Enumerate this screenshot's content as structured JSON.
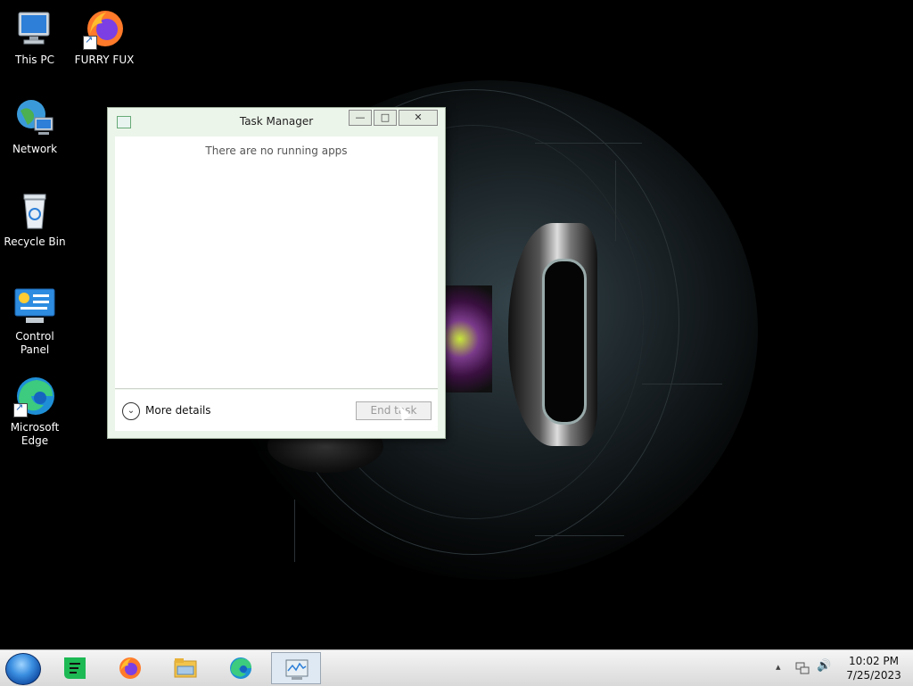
{
  "desktop": {
    "icons": [
      {
        "label": "This PC",
        "icon": "computer-icon"
      },
      {
        "label": "FURRY FUX",
        "icon": "firefox-icon"
      },
      {
        "label": "Network",
        "icon": "network-icon"
      },
      {
        "label": "Recycle Bin",
        "icon": "recycle-bin-icon"
      },
      {
        "label": "Control Panel",
        "icon": "control-panel-icon"
      },
      {
        "label": "Microsoft Edge",
        "icon": "edge-icon"
      }
    ]
  },
  "task_manager": {
    "title": "Task Manager",
    "empty_message": "There are no running apps",
    "more_details_label": "More details",
    "end_task_label": "End task",
    "minimize_glyph": "—",
    "maximize_glyph": "□",
    "close_glyph": "✕"
  },
  "taskbar": {
    "items": [
      "sheets-icon",
      "firefox-icon",
      "file-explorer-icon",
      "edge-icon",
      "task-manager-icon"
    ],
    "tray_glyphs": {
      "chevron": "▴",
      "volume": "🔊"
    },
    "time": "10:02 PM",
    "date": "7/25/2023"
  },
  "colors": {
    "accent": "#1a73d8",
    "window_bg": "#ecf5ea",
    "taskbar_bg": "#e6e6e6"
  }
}
